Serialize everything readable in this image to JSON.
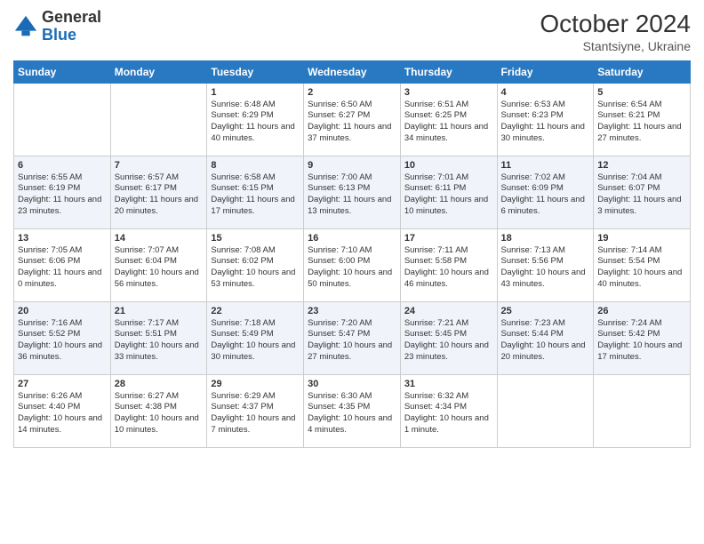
{
  "header": {
    "logo_general": "General",
    "logo_blue": "Blue",
    "month_year": "October 2024",
    "location": "Stantsiyne, Ukraine"
  },
  "weekdays": [
    "Sunday",
    "Monday",
    "Tuesday",
    "Wednesday",
    "Thursday",
    "Friday",
    "Saturday"
  ],
  "rows": [
    [
      {
        "day": "",
        "sunrise": "",
        "sunset": "",
        "daylight": ""
      },
      {
        "day": "",
        "sunrise": "",
        "sunset": "",
        "daylight": ""
      },
      {
        "day": "1",
        "sunrise": "Sunrise: 6:48 AM",
        "sunset": "Sunset: 6:29 PM",
        "daylight": "Daylight: 11 hours and 40 minutes."
      },
      {
        "day": "2",
        "sunrise": "Sunrise: 6:50 AM",
        "sunset": "Sunset: 6:27 PM",
        "daylight": "Daylight: 11 hours and 37 minutes."
      },
      {
        "day": "3",
        "sunrise": "Sunrise: 6:51 AM",
        "sunset": "Sunset: 6:25 PM",
        "daylight": "Daylight: 11 hours and 34 minutes."
      },
      {
        "day": "4",
        "sunrise": "Sunrise: 6:53 AM",
        "sunset": "Sunset: 6:23 PM",
        "daylight": "Daylight: 11 hours and 30 minutes."
      },
      {
        "day": "5",
        "sunrise": "Sunrise: 6:54 AM",
        "sunset": "Sunset: 6:21 PM",
        "daylight": "Daylight: 11 hours and 27 minutes."
      }
    ],
    [
      {
        "day": "6",
        "sunrise": "Sunrise: 6:55 AM",
        "sunset": "Sunset: 6:19 PM",
        "daylight": "Daylight: 11 hours and 23 minutes."
      },
      {
        "day": "7",
        "sunrise": "Sunrise: 6:57 AM",
        "sunset": "Sunset: 6:17 PM",
        "daylight": "Daylight: 11 hours and 20 minutes."
      },
      {
        "day": "8",
        "sunrise": "Sunrise: 6:58 AM",
        "sunset": "Sunset: 6:15 PM",
        "daylight": "Daylight: 11 hours and 17 minutes."
      },
      {
        "day": "9",
        "sunrise": "Sunrise: 7:00 AM",
        "sunset": "Sunset: 6:13 PM",
        "daylight": "Daylight: 11 hours and 13 minutes."
      },
      {
        "day": "10",
        "sunrise": "Sunrise: 7:01 AM",
        "sunset": "Sunset: 6:11 PM",
        "daylight": "Daylight: 11 hours and 10 minutes."
      },
      {
        "day": "11",
        "sunrise": "Sunrise: 7:02 AM",
        "sunset": "Sunset: 6:09 PM",
        "daylight": "Daylight: 11 hours and 6 minutes."
      },
      {
        "day": "12",
        "sunrise": "Sunrise: 7:04 AM",
        "sunset": "Sunset: 6:07 PM",
        "daylight": "Daylight: 11 hours and 3 minutes."
      }
    ],
    [
      {
        "day": "13",
        "sunrise": "Sunrise: 7:05 AM",
        "sunset": "Sunset: 6:06 PM",
        "daylight": "Daylight: 11 hours and 0 minutes."
      },
      {
        "day": "14",
        "sunrise": "Sunrise: 7:07 AM",
        "sunset": "Sunset: 6:04 PM",
        "daylight": "Daylight: 10 hours and 56 minutes."
      },
      {
        "day": "15",
        "sunrise": "Sunrise: 7:08 AM",
        "sunset": "Sunset: 6:02 PM",
        "daylight": "Daylight: 10 hours and 53 minutes."
      },
      {
        "day": "16",
        "sunrise": "Sunrise: 7:10 AM",
        "sunset": "Sunset: 6:00 PM",
        "daylight": "Daylight: 10 hours and 50 minutes."
      },
      {
        "day": "17",
        "sunrise": "Sunrise: 7:11 AM",
        "sunset": "Sunset: 5:58 PM",
        "daylight": "Daylight: 10 hours and 46 minutes."
      },
      {
        "day": "18",
        "sunrise": "Sunrise: 7:13 AM",
        "sunset": "Sunset: 5:56 PM",
        "daylight": "Daylight: 10 hours and 43 minutes."
      },
      {
        "day": "19",
        "sunrise": "Sunrise: 7:14 AM",
        "sunset": "Sunset: 5:54 PM",
        "daylight": "Daylight: 10 hours and 40 minutes."
      }
    ],
    [
      {
        "day": "20",
        "sunrise": "Sunrise: 7:16 AM",
        "sunset": "Sunset: 5:52 PM",
        "daylight": "Daylight: 10 hours and 36 minutes."
      },
      {
        "day": "21",
        "sunrise": "Sunrise: 7:17 AM",
        "sunset": "Sunset: 5:51 PM",
        "daylight": "Daylight: 10 hours and 33 minutes."
      },
      {
        "day": "22",
        "sunrise": "Sunrise: 7:18 AM",
        "sunset": "Sunset: 5:49 PM",
        "daylight": "Daylight: 10 hours and 30 minutes."
      },
      {
        "day": "23",
        "sunrise": "Sunrise: 7:20 AM",
        "sunset": "Sunset: 5:47 PM",
        "daylight": "Daylight: 10 hours and 27 minutes."
      },
      {
        "day": "24",
        "sunrise": "Sunrise: 7:21 AM",
        "sunset": "Sunset: 5:45 PM",
        "daylight": "Daylight: 10 hours and 23 minutes."
      },
      {
        "day": "25",
        "sunrise": "Sunrise: 7:23 AM",
        "sunset": "Sunset: 5:44 PM",
        "daylight": "Daylight: 10 hours and 20 minutes."
      },
      {
        "day": "26",
        "sunrise": "Sunrise: 7:24 AM",
        "sunset": "Sunset: 5:42 PM",
        "daylight": "Daylight: 10 hours and 17 minutes."
      }
    ],
    [
      {
        "day": "27",
        "sunrise": "Sunrise: 6:26 AM",
        "sunset": "Sunset: 4:40 PM",
        "daylight": "Daylight: 10 hours and 14 minutes."
      },
      {
        "day": "28",
        "sunrise": "Sunrise: 6:27 AM",
        "sunset": "Sunset: 4:38 PM",
        "daylight": "Daylight: 10 hours and 10 minutes."
      },
      {
        "day": "29",
        "sunrise": "Sunrise: 6:29 AM",
        "sunset": "Sunset: 4:37 PM",
        "daylight": "Daylight: 10 hours and 7 minutes."
      },
      {
        "day": "30",
        "sunrise": "Sunrise: 6:30 AM",
        "sunset": "Sunset: 4:35 PM",
        "daylight": "Daylight: 10 hours and 4 minutes."
      },
      {
        "day": "31",
        "sunrise": "Sunrise: 6:32 AM",
        "sunset": "Sunset: 4:34 PM",
        "daylight": "Daylight: 10 hours and 1 minute."
      },
      {
        "day": "",
        "sunrise": "",
        "sunset": "",
        "daylight": ""
      },
      {
        "day": "",
        "sunrise": "",
        "sunset": "",
        "daylight": ""
      }
    ]
  ]
}
